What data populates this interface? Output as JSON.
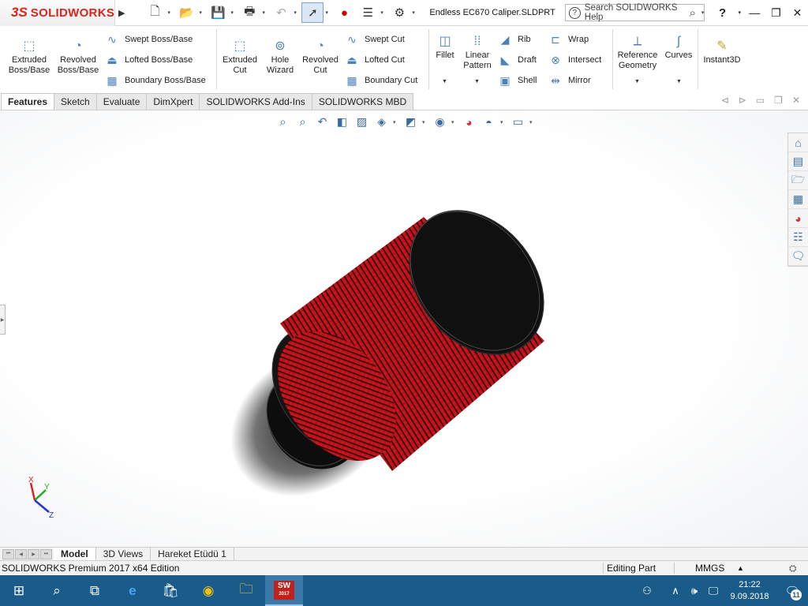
{
  "app": {
    "logo_ds": "3S",
    "logo_text": "SOLIDWORKS",
    "document_title": "Endless EC670 Caliper.SLDPRT",
    "search_placeholder": "Search SOLIDWORKS Help",
    "help_label": "?"
  },
  "command_manager": {
    "extruded_boss": "Extruded\nBoss/Base",
    "revolved_boss": "Revolved\nBoss/Base",
    "swept_boss": "Swept Boss/Base",
    "lofted_boss": "Lofted Boss/Base",
    "boundary_boss": "Boundary Boss/Base",
    "extruded_cut": "Extruded\nCut",
    "hole_wizard": "Hole\nWizard",
    "revolved_cut": "Revolved\nCut",
    "swept_cut": "Swept Cut",
    "lofted_cut": "Lofted Cut",
    "boundary_cut": "Boundary Cut",
    "fillet": "Fillet",
    "linear_pattern": "Linear\nPattern",
    "rib": "Rib",
    "draft": "Draft",
    "shell": "Shell",
    "wrap": "Wrap",
    "intersect": "Intersect",
    "mirror": "Mirror",
    "reference_geometry": "Reference\nGeometry",
    "curves": "Curves",
    "instant3d": "Instant3D"
  },
  "tabs": [
    {
      "label": "Features",
      "active": true
    },
    {
      "label": "Sketch"
    },
    {
      "label": "Evaluate"
    },
    {
      "label": "DimXpert"
    },
    {
      "label": "SOLIDWORKS Add-Ins"
    },
    {
      "label": "SOLIDWORKS MBD"
    }
  ],
  "triad": {
    "x": "X",
    "y": "Y",
    "z": "Z"
  },
  "model_tabs": [
    {
      "label": "Model",
      "active": true
    },
    {
      "label": "3D Views"
    },
    {
      "label": "Hareket Etüdü 1"
    }
  ],
  "status": {
    "edition": "SOLIDWORKS Premium 2017 x64 Edition",
    "mode": "Editing Part",
    "units": "MMGS"
  },
  "taskbar": {
    "sw_label": "SW",
    "sw_year": "2017",
    "time": "21:22",
    "date": "9.09.2018",
    "notification_count": "11"
  },
  "colors": {
    "filter_red": "#c8141b",
    "cap_black": "#111111",
    "brand_red": "#d9261c",
    "taskbar": "#1a5b8a"
  }
}
